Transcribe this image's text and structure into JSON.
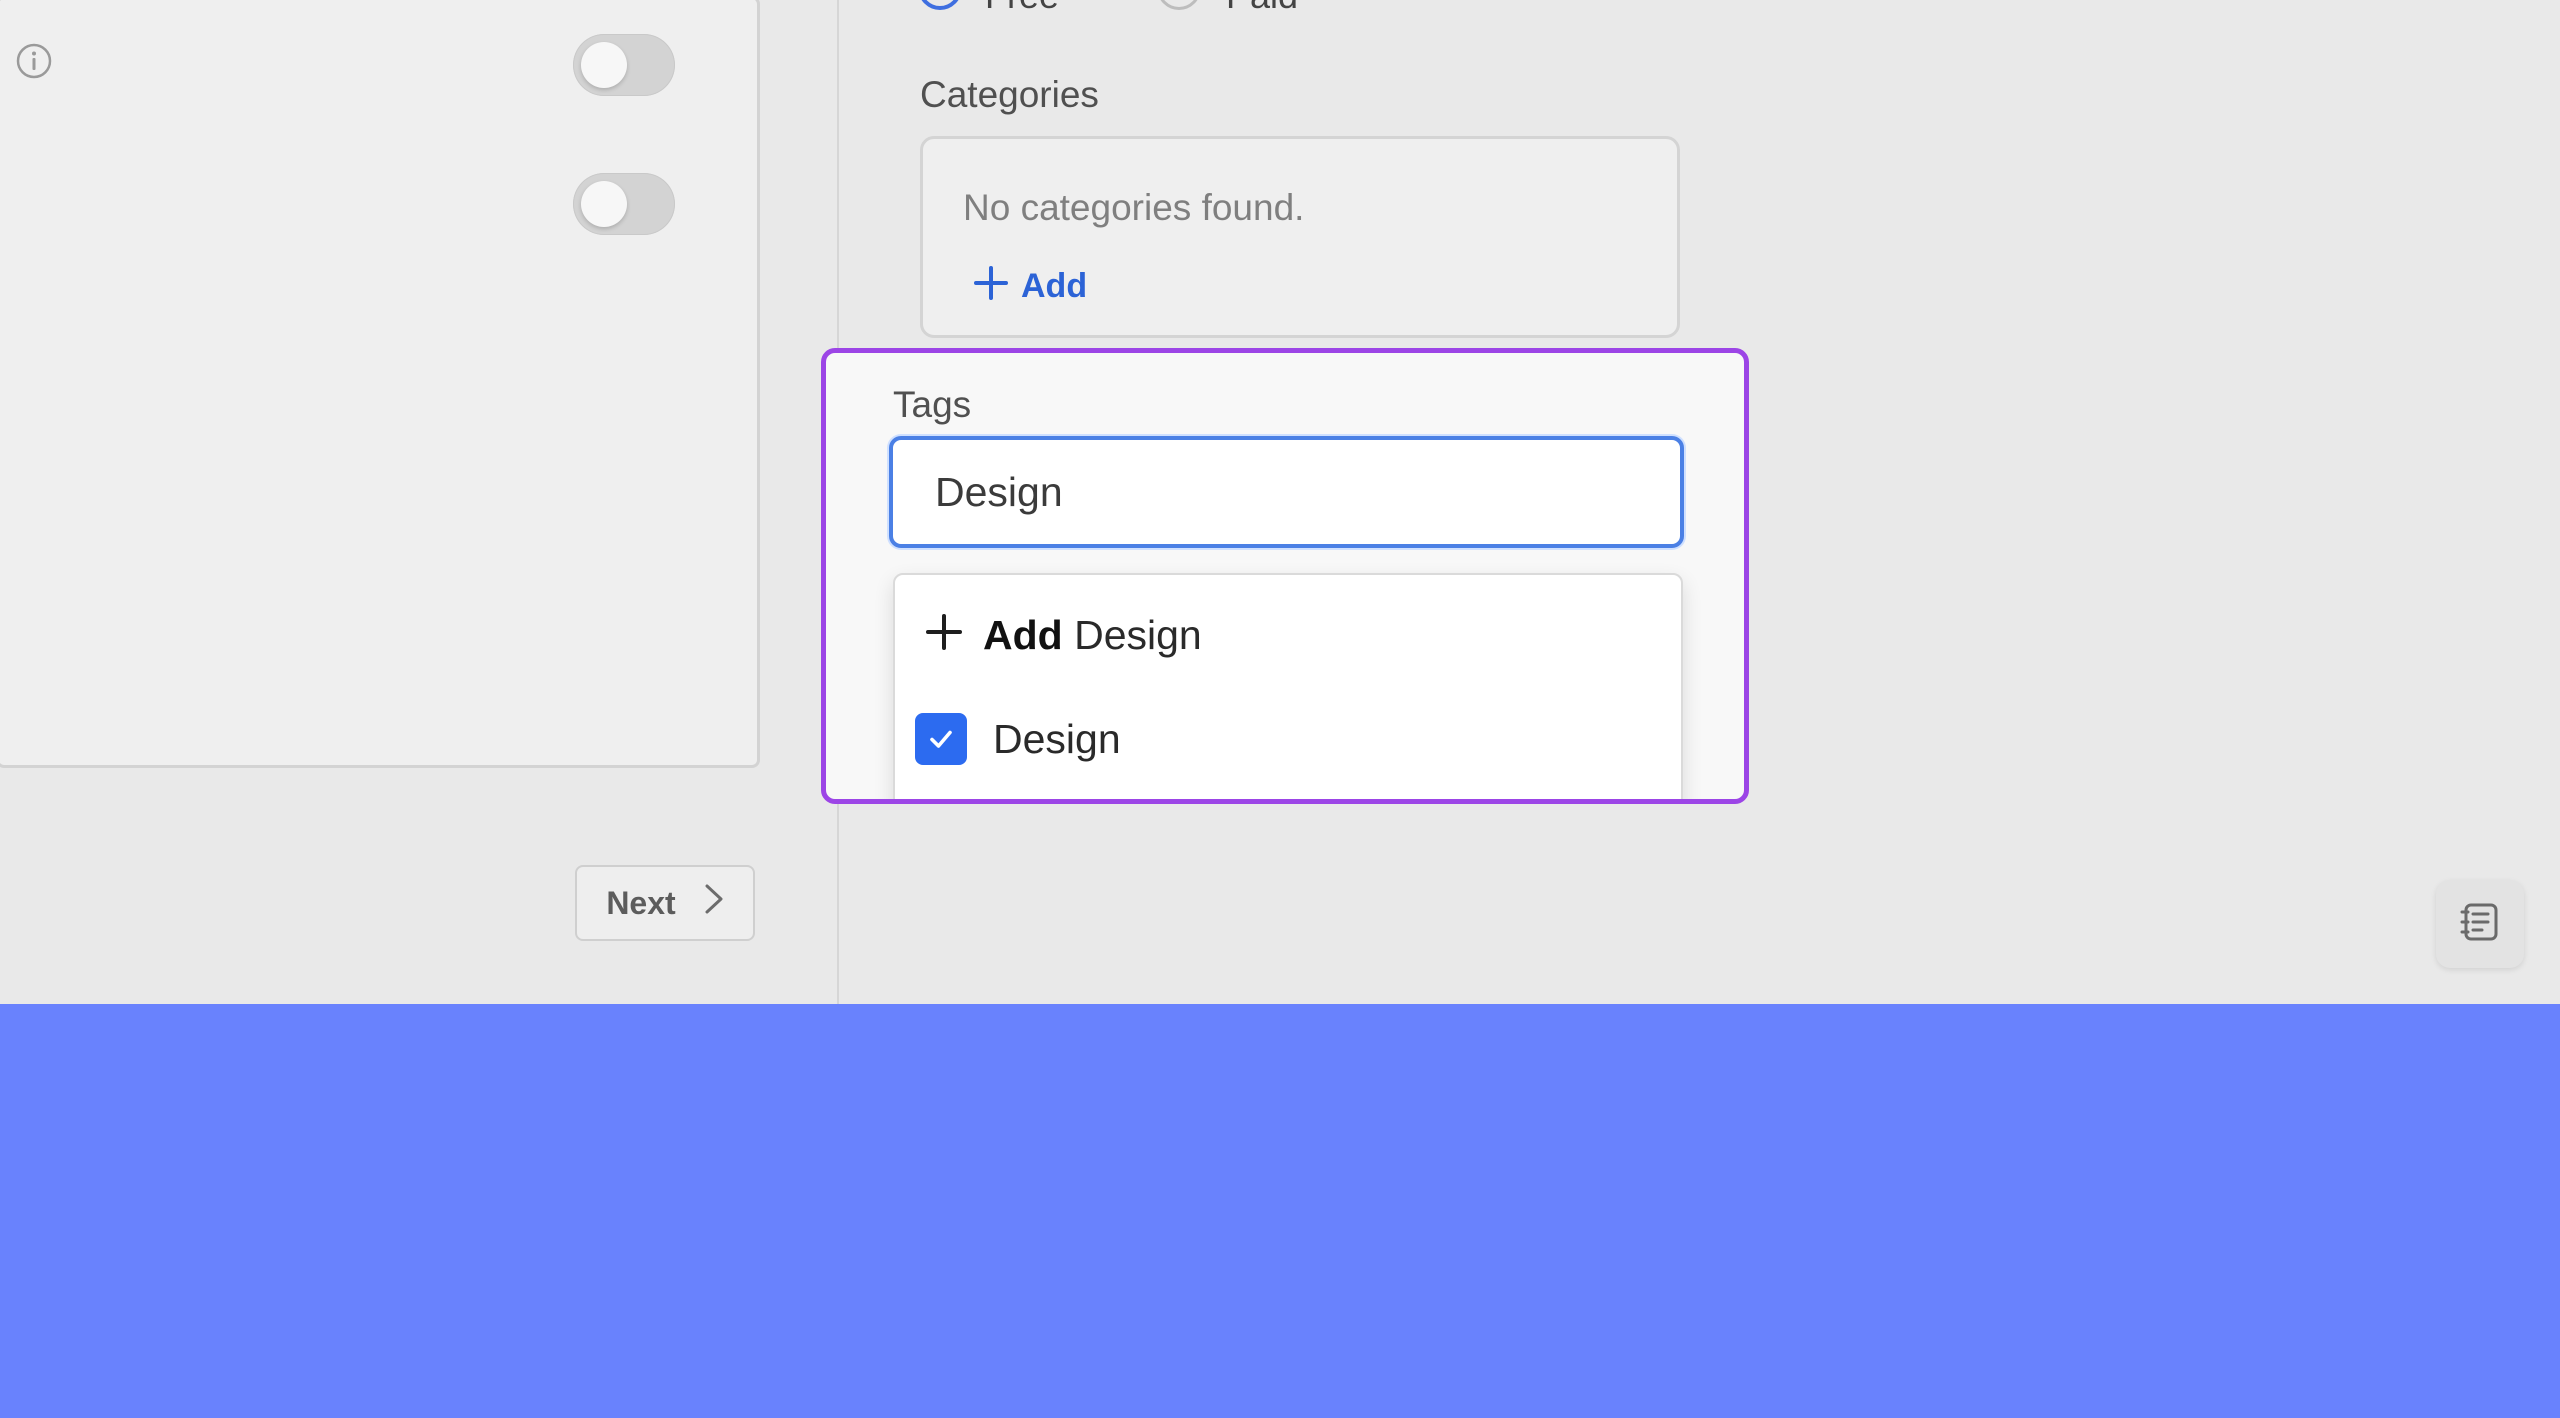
{
  "pricing": {
    "option_free": "Free",
    "option_paid": "Paid",
    "selected": "Free"
  },
  "left_panel": {
    "next_label": "Next"
  },
  "categories": {
    "label": "Categories",
    "empty_text": "No categories found.",
    "add_label": "Add"
  },
  "tags": {
    "label": "Tags",
    "input_value": "Design",
    "dropdown": {
      "add_prefix": "Add",
      "add_value": "Design",
      "options": [
        {
          "label": "Design",
          "checked": true
        }
      ]
    }
  },
  "colors": {
    "accent": "#2c63d6",
    "highlight": "#9c45e6",
    "background": "#6982fd"
  }
}
